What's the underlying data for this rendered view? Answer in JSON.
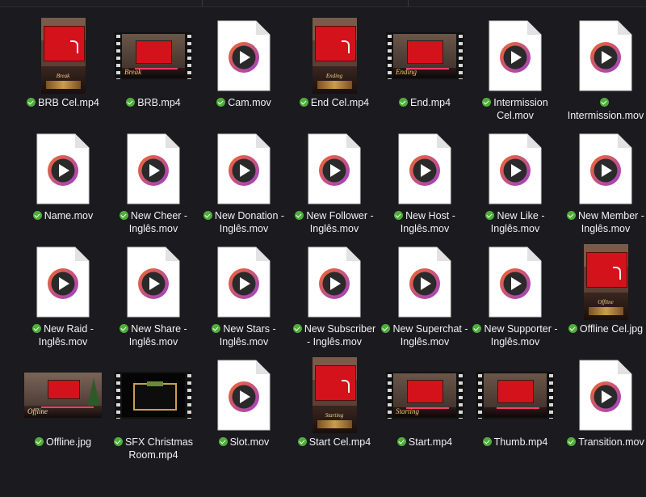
{
  "files": [
    {
      "name": "BRB Cel.mp4",
      "thumb": "portrait",
      "caption": "Break"
    },
    {
      "name": "BRB.mp4",
      "thumb": "film",
      "caption": "Break"
    },
    {
      "name": "Cam.mov",
      "thumb": "doc"
    },
    {
      "name": "End Cel.mp4",
      "thumb": "portrait",
      "caption": "Ending"
    },
    {
      "name": "End.mp4",
      "thumb": "film",
      "caption": "Ending"
    },
    {
      "name": "Intermission Cel.mov",
      "thumb": "doc"
    },
    {
      "name": "Intermission.mov",
      "thumb": "doc"
    },
    {
      "name": "Name.mov",
      "thumb": "doc"
    },
    {
      "name": "New Cheer - Inglês.mov",
      "thumb": "doc"
    },
    {
      "name": "New Donation - Inglês.mov",
      "thumb": "doc"
    },
    {
      "name": "New Follower - Inglês.mov",
      "thumb": "doc"
    },
    {
      "name": "New Host - Inglês.mov",
      "thumb": "doc"
    },
    {
      "name": "New Like - Inglês.mov",
      "thumb": "doc"
    },
    {
      "name": "New Member - Inglês.mov",
      "thumb": "doc"
    },
    {
      "name": "New Raid - Inglês.mov",
      "thumb": "doc"
    },
    {
      "name": "New Share - Inglês.mov",
      "thumb": "doc"
    },
    {
      "name": "New Stars - Inglês.mov",
      "thumb": "doc"
    },
    {
      "name": "New Subscriber - Inglês.mov",
      "thumb": "doc"
    },
    {
      "name": "New Superchat - Inglês.mov",
      "thumb": "doc"
    },
    {
      "name": "New Supporter - Inglês.mov",
      "thumb": "doc"
    },
    {
      "name": "Offline Cel.jpg",
      "thumb": "portrait",
      "caption": "Offline"
    },
    {
      "name": "Offline.jpg",
      "thumb": "photo",
      "caption": "Offline"
    },
    {
      "name": "SFX Christmas Room.mp4",
      "thumb": "film-dark"
    },
    {
      "name": "Slot.mov",
      "thumb": "doc"
    },
    {
      "name": "Start Cel.mp4",
      "thumb": "portrait",
      "caption": "Starting"
    },
    {
      "name": "Start.mp4",
      "thumb": "film",
      "caption": "Starting"
    },
    {
      "name": "Thumb.mp4",
      "thumb": "film",
      "caption": ""
    },
    {
      "name": "Transition.mov",
      "thumb": "doc"
    }
  ],
  "colors": {
    "background": "#1a1a1f",
    "sync_check": "#4fae3a",
    "label_text": "#f2f2f2",
    "player_ring_orange": "#f2682a",
    "player_ring_purple": "#9b3fd0"
  },
  "icons": {
    "movie_file": "media-player-file-icon",
    "status": "synced-check-icon"
  }
}
